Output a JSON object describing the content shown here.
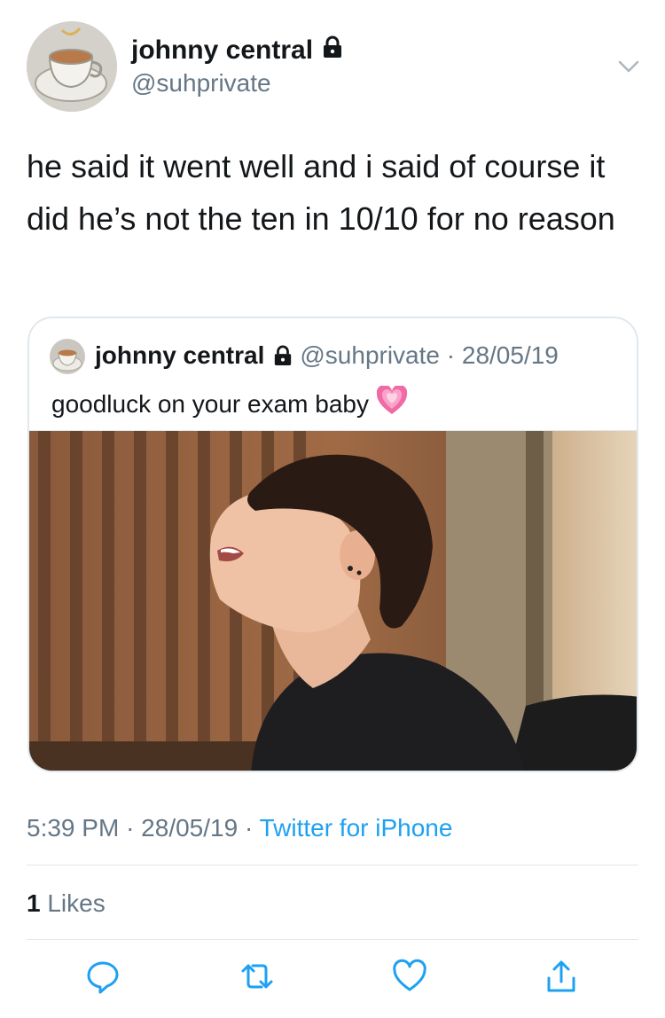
{
  "tweet": {
    "display_name": "johnny central",
    "handle": "@suhprivate",
    "text": "he said it went well and i said of course it did he’s not the ten in 10/10 for no reason",
    "time": "5:39 PM",
    "date": "28/05/19",
    "source": "Twitter for iPhone",
    "likes_count": "1",
    "likes_label": "Likes"
  },
  "quoted": {
    "display_name": "johnny central",
    "handle": "@suhprivate",
    "date": "28/05/19",
    "text": "goodluck on your exam baby",
    "emoji_icon": "growing-heart-icon"
  },
  "icons": {
    "lock": "lock-icon",
    "chevron": "chevron-down-icon",
    "reply": "reply-icon",
    "retweet": "retweet-icon",
    "like": "heart-icon",
    "share": "share-icon"
  },
  "colors": {
    "text": "#14171a",
    "secondary": "#657786",
    "link": "#1da1f2",
    "border": "#e1e8ed",
    "icon": "#1da1f2"
  }
}
